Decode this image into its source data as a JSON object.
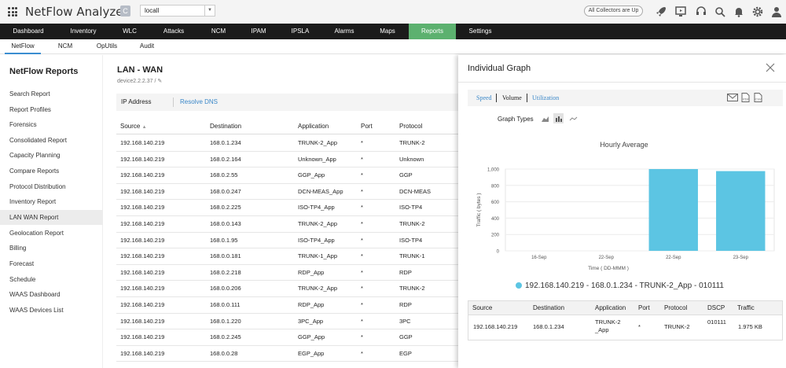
{
  "app": {
    "title": "NetFlow Analyzer",
    "badge": "C",
    "instance": "locall",
    "collectors_status": "All Collectors are Up"
  },
  "top_icons": [
    "rocket-icon",
    "monitor-icon",
    "headset-icon",
    "search-icon",
    "bell-icon",
    "gear-icon",
    "user-icon"
  ],
  "nav": [
    {
      "label": "Dashboard"
    },
    {
      "label": "Inventory"
    },
    {
      "label": "WLC"
    },
    {
      "label": "Attacks"
    },
    {
      "label": "NCM"
    },
    {
      "label": "IPAM"
    },
    {
      "label": "IPSLA"
    },
    {
      "label": "Alarms"
    },
    {
      "label": "Maps"
    },
    {
      "label": "Reports",
      "active": true
    },
    {
      "label": "Settings"
    }
  ],
  "subnav": [
    {
      "label": "NetFlow",
      "active": true
    },
    {
      "label": "NCM"
    },
    {
      "label": "OpUtils"
    },
    {
      "label": "Audit"
    }
  ],
  "sidebar": {
    "title": "NetFlow Reports",
    "items": [
      {
        "label": "Search Report"
      },
      {
        "label": "Report Profiles"
      },
      {
        "label": "Forensics"
      },
      {
        "label": "Consolidated Report"
      },
      {
        "label": "Capacity Planning"
      },
      {
        "label": "Compare Reports"
      },
      {
        "label": "Protocol Distribution"
      },
      {
        "label": "Inventory Report"
      },
      {
        "label": "LAN WAN Report",
        "active": true
      },
      {
        "label": "Geolocation Report"
      },
      {
        "label": "Billing"
      },
      {
        "label": "Forecast"
      },
      {
        "label": "Schedule"
      },
      {
        "label": "WAAS Dashboard"
      },
      {
        "label": "WAAS Devices List"
      }
    ]
  },
  "main": {
    "title": "LAN - WAN",
    "subtitle": "device2.2.2.37",
    "subtitle_sep": "/",
    "tab_ip": "IP Address",
    "tab_dns": "Resolve DNS",
    "columns": [
      "Source",
      "Destination",
      "Application",
      "Port",
      "Protocol"
    ],
    "rows": [
      [
        "192.168.140.219",
        "168.0.1.234",
        "TRUNK-2_App",
        "*",
        "TRUNK-2"
      ],
      [
        "192.168.140.219",
        "168.0.2.164",
        "Unknown_App",
        "*",
        "Unknown"
      ],
      [
        "192.168.140.219",
        "168.0.2.55",
        "GGP_App",
        "*",
        "GGP"
      ],
      [
        "192.168.140.219",
        "168.0.0.247",
        "DCN-MEAS_App",
        "*",
        "DCN-MEAS"
      ],
      [
        "192.168.140.219",
        "168.0.2.225",
        "ISO-TP4_App",
        "*",
        "ISO-TP4"
      ],
      [
        "192.168.140.219",
        "168.0.0.143",
        "TRUNK-2_App",
        "*",
        "TRUNK-2"
      ],
      [
        "192.168.140.219",
        "168.0.1.95",
        "ISO-TP4_App",
        "*",
        "ISO-TP4"
      ],
      [
        "192.168.140.219",
        "168.0.0.181",
        "TRUNK-1_App",
        "*",
        "TRUNK-1"
      ],
      [
        "192.168.140.219",
        "168.0.2.218",
        "RDP_App",
        "*",
        "RDP"
      ],
      [
        "192.168.140.219",
        "168.0.0.206",
        "TRUNK-2_App",
        "*",
        "TRUNK-2"
      ],
      [
        "192.168.140.219",
        "168.0.0.111",
        "RDP_App",
        "*",
        "RDP"
      ],
      [
        "192.168.140.219",
        "168.0.1.220",
        "3PC_App",
        "*",
        "3PC"
      ],
      [
        "192.168.140.219",
        "168.0.2.245",
        "GGP_App",
        "*",
        "GGP"
      ],
      [
        "192.168.140.219",
        "168.0.0.28",
        "EGP_App",
        "*",
        "EGP"
      ]
    ]
  },
  "panel": {
    "title": "Individual Graph",
    "graph_tabs": [
      "Speed",
      "Volume",
      "Utilization"
    ],
    "graph_types_label": "Graph Types",
    "legend": "192.168.140.219 - 168.0.1.234 - TRUNK-2_App - 010111",
    "detail_columns": [
      "Source",
      "Destination",
      "Application",
      "Port",
      "Protocol",
      "DSCP",
      "Traffic"
    ],
    "detail_row": [
      "192.168.140.219",
      "168.0.1.234",
      "TRUNK-2_App",
      "*",
      "TRUNK-2",
      "010111",
      "1.975 KB"
    ]
  },
  "chart_data": {
    "type": "bar",
    "title": "Hourly Average",
    "xlabel": "Time ( DD-MMM )",
    "ylabel": "Traffic ( bytes )",
    "categories": [
      "16-Sep",
      "22-Sep",
      "22-Sep",
      "23-Sep"
    ],
    "values": [
      0,
      0,
      1000,
      975
    ],
    "yticks": [
      "0",
      "200",
      "400",
      "600",
      "800",
      "1,000"
    ],
    "ylim": [
      0,
      1000
    ],
    "bar_color": "#5cc5e3",
    "grid": true
  }
}
